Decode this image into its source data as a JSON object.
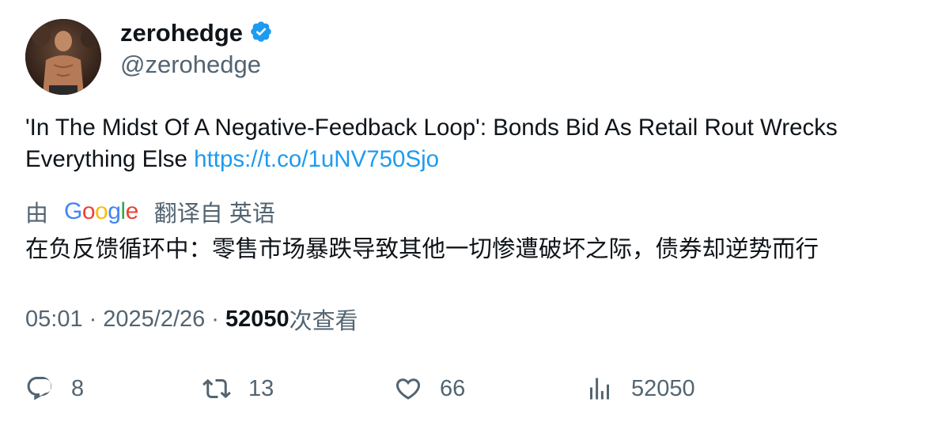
{
  "user": {
    "display_name": "zerohedge",
    "handle": "@zerohedge",
    "verified": true,
    "verified_color": "#1d9bf0"
  },
  "tweet": {
    "text": "'In The Midst Of A Negative-Feedback Loop': Bonds Bid As Retail Rout Wrecks Everything Else ",
    "link": "https://t.co/1uNV750Sjo",
    "link_color": "#1d9bf0"
  },
  "translation": {
    "prefix": "由",
    "provider_logo": "Google",
    "suffix": "翻译自 英语",
    "text": "在负反馈循环中：零售市场暴跌导致其他一切惨遭破坏之际，债券却逆势而行"
  },
  "meta": {
    "time": "05:01",
    "separator": "·",
    "date": "2025/2/26",
    "views_count": "52050",
    "views_label": "次查看"
  },
  "actions": {
    "replies": "8",
    "retweets": "13",
    "likes": "66",
    "views": "52050"
  },
  "icons": [
    "reply-icon",
    "retweet-icon",
    "like-icon",
    "views-icon",
    "verified-badge-icon"
  ]
}
